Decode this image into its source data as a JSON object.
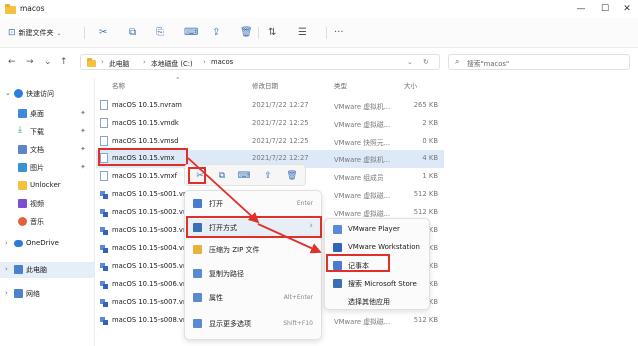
{
  "window": {
    "title": "macos"
  },
  "toolbar": {
    "new_label": "新建文件夹",
    "sort_label": "⇅",
    "view_label": "☰",
    "more_label": "···"
  },
  "address": {
    "back": "←",
    "forward": "→",
    "dropdown": "⌄",
    "up": "↑",
    "segments": [
      "此电脑",
      "本地磁盘 (C:)",
      "macos"
    ],
    "search_placeholder": "搜索\"macos\""
  },
  "sidebar": {
    "items": [
      {
        "label": "快速访问",
        "color": "#2d7de0"
      },
      {
        "label": "桌面",
        "color": "#3f8ad8"
      },
      {
        "label": "下载",
        "color": "#2e9b52"
      },
      {
        "label": "文档",
        "color": "#5b86c9"
      },
      {
        "label": "图片",
        "color": "#3a92d4"
      },
      {
        "label": "Unlocker",
        "color": "#f3c33e"
      },
      {
        "label": "视频",
        "color": "#7c4fd0"
      },
      {
        "label": "音乐",
        "color": "#e2613a"
      },
      {
        "label": "OneDrive",
        "color": "#2c7ad6"
      },
      {
        "label": "此电脑",
        "color": "#4a83cc"
      },
      {
        "label": "网络",
        "color": "#4a83cc"
      }
    ]
  },
  "columns": {
    "name": "名称",
    "date": "修改日期",
    "type": "类型",
    "size": "大小"
  },
  "files": [
    {
      "name": "macOS 10.15.nvram",
      "date": "2021/7/22 12:27",
      "type": "VMware 虚拟机...",
      "size": "265 KB",
      "icon": "doc"
    },
    {
      "name": "macOS 10.15.vmdk",
      "date": "2021/7/22 12:25",
      "type": "VMware 虚拟磁...",
      "size": "2 KB",
      "icon": "doc"
    },
    {
      "name": "macOS 10.15.vmsd",
      "date": "2021/7/22 12:25",
      "type": "VMware 快照元...",
      "size": "0 KB",
      "icon": "doc"
    },
    {
      "name": "macOS 10.15.vmx",
      "date": "2021/7/22 12:27",
      "type": "VMware 虚拟机...",
      "size": "4 KB",
      "icon": "doc"
    },
    {
      "name": "macOS 10.15.vmxf",
      "date": "",
      "type": "VMware 组成员",
      "size": "1 KB",
      "icon": "doc"
    },
    {
      "name": "macOS 10.15-s001.vm",
      "date": "",
      "type": "VMware 虚拟磁...",
      "size": "512 KB",
      "icon": "vm"
    },
    {
      "name": "macOS 10.15-s002.vm",
      "date": "",
      "type": "VMware 虚拟磁...",
      "size": "512 KB",
      "icon": "vm"
    },
    {
      "name": "macOS 10.15-s003.vm",
      "date": "",
      "type": "",
      "size": "KB",
      "icon": "vm"
    },
    {
      "name": "macOS 10.15-s004.vm",
      "date": "",
      "type": "",
      "size": "KB",
      "icon": "vm"
    },
    {
      "name": "macOS 10.15-s005.vm",
      "date": "",
      "type": "",
      "size": "KB",
      "icon": "vm"
    },
    {
      "name": "macOS 10.15-s006.vm",
      "date": "",
      "type": "",
      "size": "KB",
      "icon": "vm"
    },
    {
      "name": "macOS 10.15-s007.vm",
      "date": "",
      "type": "",
      "size": "512 KB",
      "icon": "vm"
    },
    {
      "name": "macOS 10.15-s008.vm",
      "date": "",
      "type": "VMware 虚拟磁...",
      "size": "512 KB",
      "icon": "vm"
    }
  ],
  "context_menu": {
    "items": [
      {
        "label": "打开",
        "shortcut": "Enter",
        "color": "#4a7bd0"
      },
      {
        "label": "打开方式",
        "shortcut": "›",
        "color": "#3a6fb8"
      },
      {
        "label": "压缩为 ZIP 文件",
        "shortcut": "",
        "color": "#e8b13a"
      },
      {
        "label": "复制为路径",
        "shortcut": "",
        "color": "#5a8ad0"
      },
      {
        "label": "属性",
        "shortcut": "Alt+Enter",
        "color": "#5a8ad0"
      },
      {
        "label": "显示更多选项",
        "shortcut": "Shift+F10",
        "color": "#5a8ad0"
      }
    ]
  },
  "submenu": {
    "items": [
      {
        "label": "VMware Player",
        "color": "#5b8ad6"
      },
      {
        "label": "VMware Workstation",
        "color": "#3264b8"
      },
      {
        "label": "记事本",
        "color": "#4a7bd0"
      },
      {
        "label": "搜索 Microsoft Store",
        "color": "#3a6fb8"
      },
      {
        "label": "选择其他应用",
        "color": ""
      }
    ]
  },
  "accent": "#e0302a"
}
